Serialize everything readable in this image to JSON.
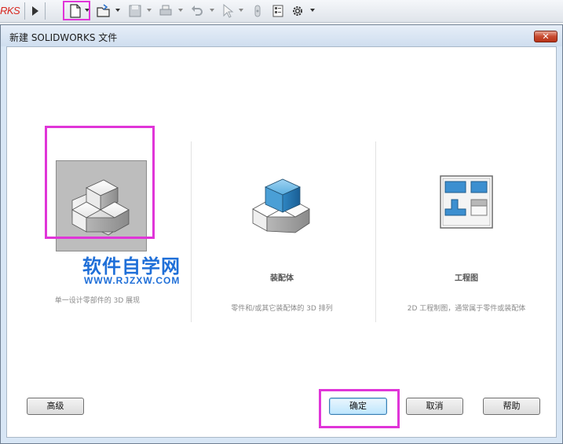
{
  "toolbar": {
    "brand": "RKS",
    "icons": [
      "play-arrow-icon",
      "new-document-icon",
      "open-folder-icon",
      "save-icon",
      "print-icon",
      "undo-icon",
      "select-cursor-icon",
      "rebuild-icon",
      "file-properties-icon",
      "options-gear-icon"
    ]
  },
  "dialog": {
    "title": "新建 SOLIDWORKS 文件",
    "close_label": "✕",
    "templates": [
      {
        "label": "",
        "description": "单一设计零部件的 3D 展现",
        "selected": true
      },
      {
        "label": "装配体",
        "description": "零件和/或其它装配体的 3D 排列",
        "selected": false
      },
      {
        "label": "工程图",
        "description": "2D 工程制图，通常属于零件或装配体",
        "selected": false
      }
    ],
    "watermark": {
      "text": "软件自学网",
      "url": "WWW.RJZXW.COM"
    },
    "buttons": {
      "advanced": "高级",
      "ok": "确定",
      "cancel": "取消",
      "help": "帮助"
    }
  },
  "colors": {
    "highlight": "#e035d8",
    "watermark": "#1f6fd8",
    "brand": "#d8271f",
    "selection_bg": "#bdbdbd"
  }
}
